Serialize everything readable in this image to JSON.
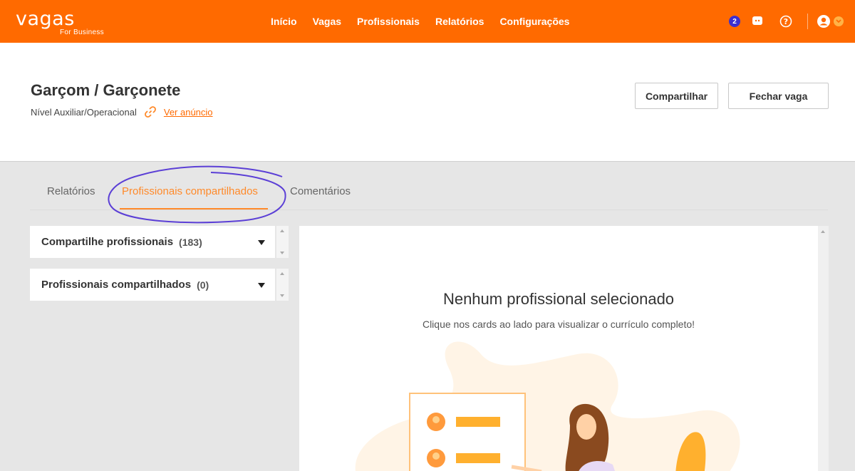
{
  "brand": {
    "name": "vagas",
    "sub": "For Business",
    "accent": "#ff6a00"
  },
  "nav": {
    "items": [
      "Início",
      "Vagas",
      "Profissionais",
      "Relatórios",
      "Configurações"
    ]
  },
  "topbar": {
    "notifications_count": "2"
  },
  "job": {
    "title": "Garçom / Garçonete",
    "level": "Nível Auxiliar/Operacional",
    "link_label": "Ver anúncio",
    "share_label": "Compartilhar",
    "close_label": "Fechar vaga"
  },
  "tabs": {
    "reports": "Relatórios",
    "shared": "Profissionais compartilhados",
    "comments": "Comentários"
  },
  "panels": {
    "share": {
      "label": "Compartilhe profissionais",
      "count": "(183)"
    },
    "shared": {
      "label": "Profissionais compartilhados",
      "count": "(0)"
    }
  },
  "empty": {
    "title": "Nenhum profissional selecionado",
    "subtitle": "Clique nos cards ao lado para visualizar o currículo completo!"
  }
}
